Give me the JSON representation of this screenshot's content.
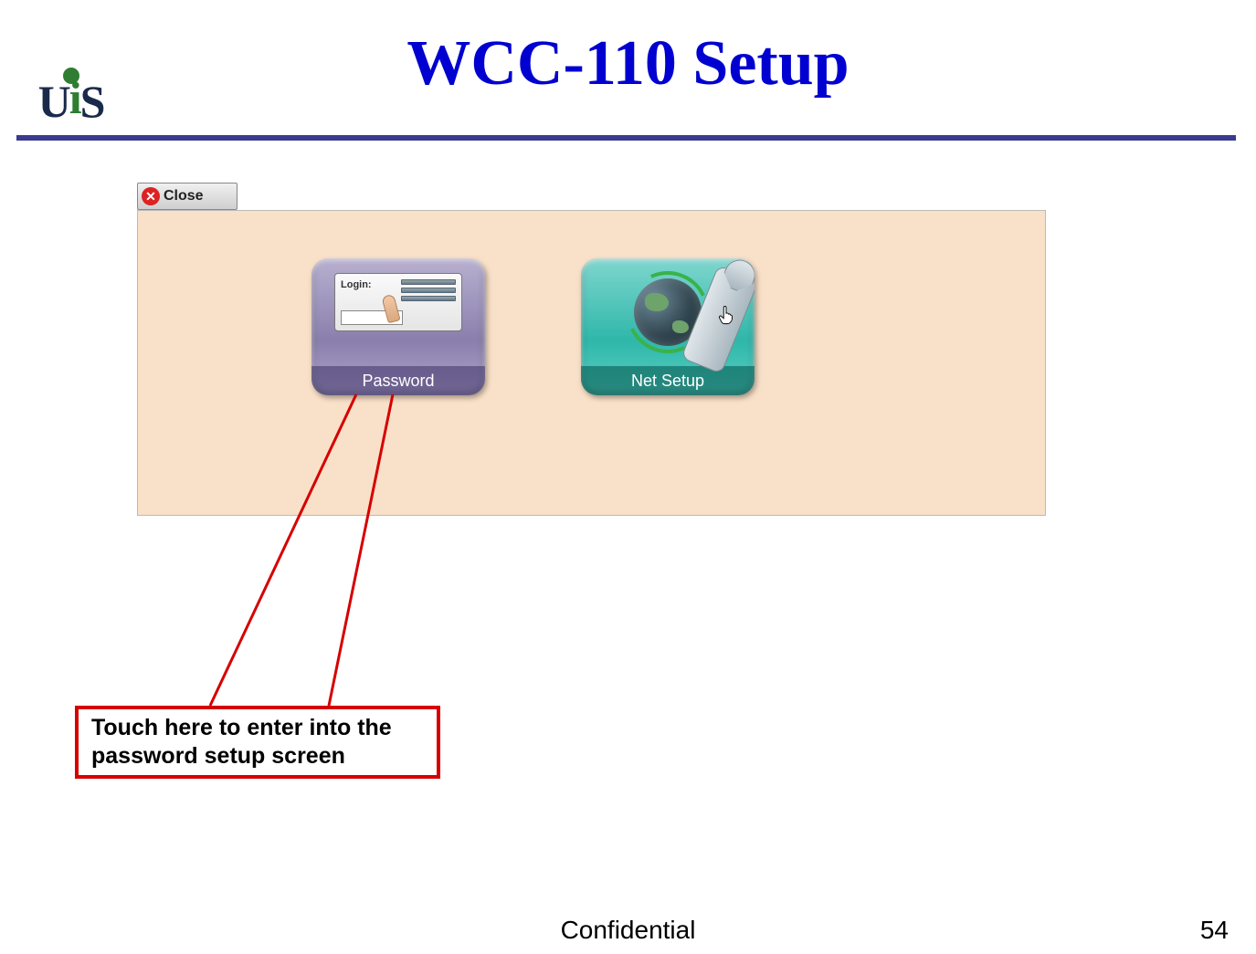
{
  "logo": {
    "text_u": "U",
    "text_i": "i",
    "text_s": "S"
  },
  "header": {
    "title": "WCC-110 Setup"
  },
  "close": {
    "label": "Close"
  },
  "tiles": {
    "password": {
      "label": "Password",
      "login_label": "Login:"
    },
    "net": {
      "label": "Net Setup"
    }
  },
  "callout": {
    "text": "Touch here to enter into the password setup screen"
  },
  "footer": {
    "confidential": "Confidential",
    "page": "54"
  },
  "colors": {
    "title": "#0000d0",
    "rule": "#3a3a8e",
    "callout_border": "#d60000",
    "panel_bg": "#f9e0c8"
  }
}
